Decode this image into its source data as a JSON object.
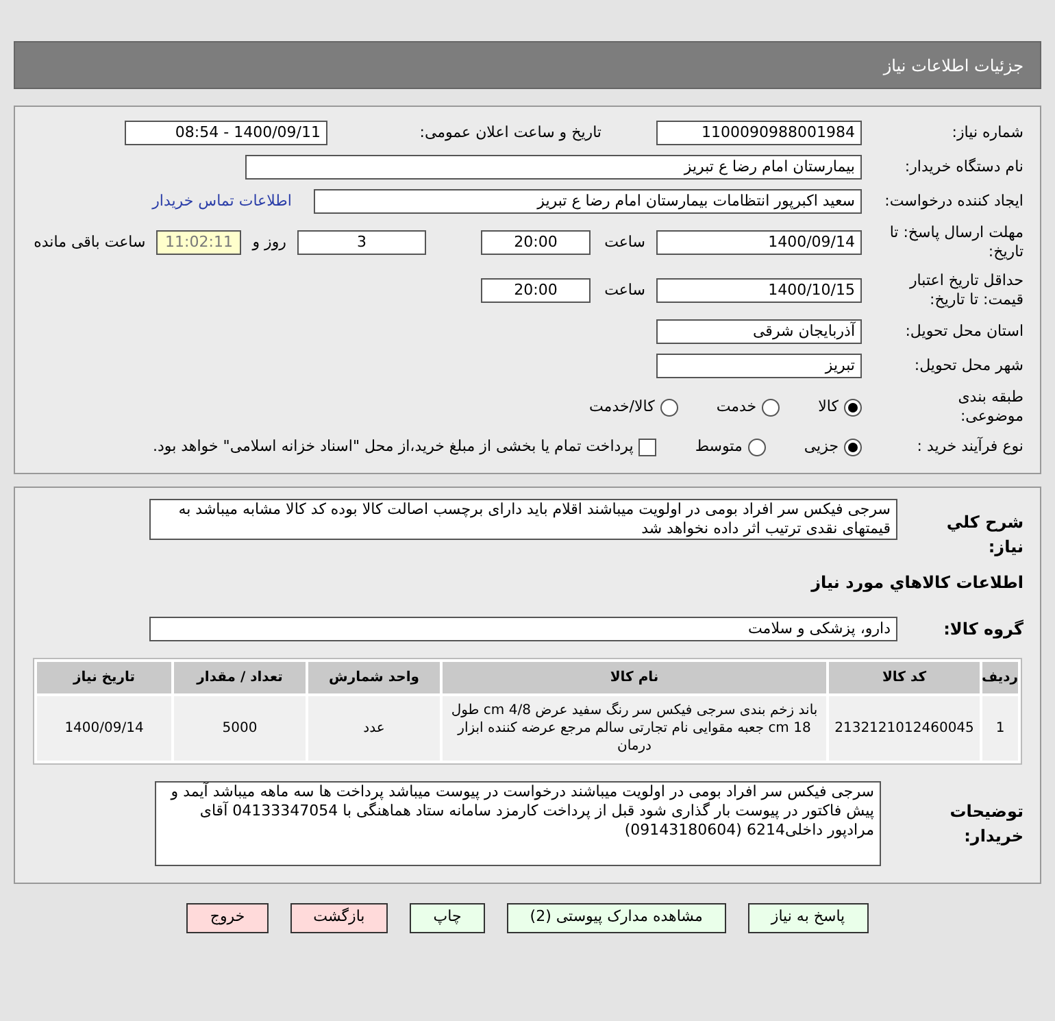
{
  "header": {
    "title": "جزئیات اطلاعات نیاز"
  },
  "details": {
    "need_number": {
      "label": "شماره نیاز:",
      "value": "1100090988001984"
    },
    "announce": {
      "label": "تاریخ و ساعت اعلان عمومی:",
      "value": "1400/09/11 - 08:54"
    },
    "buyer": {
      "label": "نام دستگاه خریدار:",
      "value": "بیمارستان امام رضا  ع  تبریز"
    },
    "creator": {
      "label": "ایجاد کننده درخواست:",
      "value": "سعید اکبرپور انتظامات بیمارستان امام رضا  ع  تبریز",
      "link": "اطلاعات تماس خریدار"
    },
    "deadline": {
      "label": "مهلت ارسال پاسخ: تا تاریخ:",
      "date": "1400/09/14",
      "time_label": "ساعت",
      "time": "20:00",
      "days": "3",
      "days_label": "روز و",
      "remaining": "11:02:11",
      "remaining_label": "ساعت باقی مانده"
    },
    "validity": {
      "label": "حداقل تاریخ اعتبار قیمت: تا تاریخ:",
      "date": "1400/10/15",
      "time_label": "ساعت",
      "time": "20:00"
    },
    "province": {
      "label": "استان محل تحویل:",
      "value": "آذربایجان شرقی"
    },
    "city": {
      "label": "شهر محل تحویل:",
      "value": "تبریز"
    },
    "category": {
      "label": "طبقه بندی موضوعی:",
      "options": [
        {
          "label": "کالا",
          "selected": true
        },
        {
          "label": "خدمت",
          "selected": false
        },
        {
          "label": "کالا/خدمت",
          "selected": false
        }
      ]
    },
    "process": {
      "label": "نوع فرآیند خرید :",
      "options": [
        {
          "label": "جزیی",
          "selected": true
        },
        {
          "label": "متوسط",
          "selected": false
        }
      ],
      "payment": {
        "label": "پرداخت تمام یا بخشی از مبلغ خرید،از محل \"اسناد خزانه اسلامی\" خواهد بود.",
        "checked": false
      }
    }
  },
  "needs": {
    "summary": {
      "label": "شرح كلي نياز:",
      "value": "سرجی فیکس سر افراد بومی در اولویت میباشند اقلام باید دارای برچسب اصالت کالا بوده کد کالا مشابه میباشد به قیمتهای نقدی ترتیب اثر داده نخواهد شد"
    },
    "heading": "اطلاعات كالاهاي مورد نياز",
    "group": {
      "label": "گروه کالا:",
      "value": "دارو، پزشکی و سلامت"
    },
    "table": {
      "columns": [
        "ردیف",
        "کد کالا",
        "نام کالا",
        "واحد شمارش",
        "تعداد / مقدار",
        "تاریخ نیاز"
      ],
      "rows": [
        [
          "1",
          "2132121012460045",
          "باند زخم بندی سرجی فیکس سر رنگ سفید عرض 4/8 cm طول 18 cm جعبه مقوایی نام تجارتی سالم مرجع عرضه کننده ابزار درمان",
          "عدد",
          "5000",
          "1400/09/14"
        ]
      ]
    },
    "buyer_notes": {
      "label": "توضیحات خریدار:",
      "value": "سرجی فیکس سر افراد بومی در اولویت میباشند درخواست در پیوست میباشد پرداخت ها سه ماهه میباشد آیمد و پیش فاکتور در پیوست بار گذاری شود قبل از پرداخت کارمزد سامانه ستاد هماهنگی با 04133347054  آقای مرادپور داخلی6214 (09143180604)"
    }
  },
  "buttons": [
    {
      "label": "پاسخ به نیاز",
      "kind": "action"
    },
    {
      "label": "مشاهده مدارک پیوستی (2)",
      "kind": "action"
    },
    {
      "label": "چاپ",
      "kind": "action"
    },
    {
      "label": "بازگشت",
      "kind": "exit"
    },
    {
      "label": "خروج",
      "kind": "exit"
    }
  ]
}
